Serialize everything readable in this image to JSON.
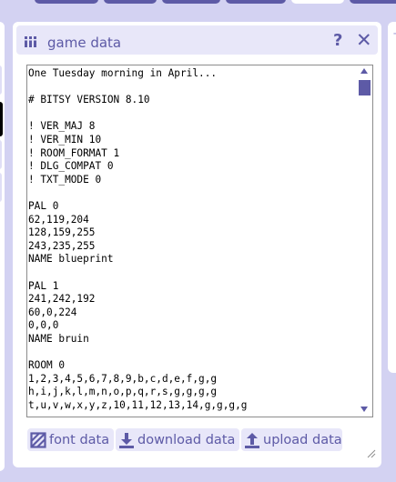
{
  "window": {
    "title": "game data",
    "help_label": "?",
    "close_label": "✕"
  },
  "icons": {
    "grip": "grid-dots-icon",
    "help": "question-icon",
    "close": "close-icon",
    "font": "font-icon",
    "download": "download-icon",
    "upload": "upload-icon"
  },
  "editor": {
    "content": "One Tuesday morning in April...\n\n# BITSY VERSION 8.10\n\n! VER_MAJ 8\n! VER_MIN 10\n! ROOM_FORMAT 1\n! DLG_COMPAT 0\n! TXT_MODE 0\n\nPAL 0\n62,119,204\n128,159,255\n243,235,255\nNAME blueprint\n\nPAL 1\n241,242,192\n60,0,224\n0,0,0\nNAME bruin\n\nROOM 0\n1,2,3,4,5,6,7,8,9,b,c,d,e,f,g,g\nh,i,j,k,l,m,n,o,p,q,r,s,g,g,g,g\nt,u,v,w,x,y,z,10,11,12,13,14,g,g,g,g"
  },
  "buttons": {
    "font_data": "font data",
    "download_data": "download data",
    "upload_data": "upload data"
  },
  "side": {
    "right_glyph": "⊤"
  },
  "colors": {
    "accent": "#5d5aa6",
    "background": "#d3d2f2",
    "header_bg": "#e8e7f9",
    "panel_bg": "#ffffff"
  }
}
